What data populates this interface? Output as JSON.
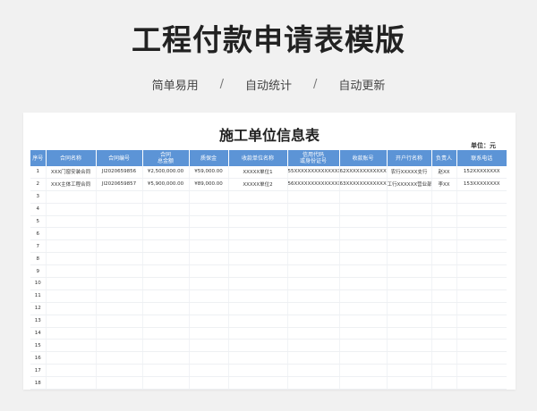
{
  "header": {
    "title": "工程付款申请表模版",
    "taglines": [
      "简单易用",
      "自动统计",
      "自动更新"
    ],
    "separator": "/"
  },
  "sheet": {
    "title": "施工单位信息表",
    "unit": "单位：元",
    "columns": [
      {
        "line1": "序号",
        "line2": ""
      },
      {
        "line1": "合同名称",
        "line2": ""
      },
      {
        "line1": "合同编号",
        "line2": ""
      },
      {
        "line1": "合同",
        "line2": "总金额"
      },
      {
        "line1": "质保金",
        "line2": ""
      },
      {
        "line1": "收款单位名称",
        "line2": ""
      },
      {
        "line1": "信用代码",
        "line2": "或身份证号"
      },
      {
        "line1": "收款账号",
        "line2": ""
      },
      {
        "line1": "开户行名称",
        "line2": ""
      },
      {
        "line1": "负责人",
        "line2": ""
      },
      {
        "line1": "联系电话",
        "line2": ""
      }
    ],
    "rows": [
      [
        "1",
        "XXX门窗安装合同",
        "JI2020659856",
        "¥2,500,000.00",
        "¥59,000.00",
        "XXXXX单位1",
        "55XXXXXXXXXXXXXX",
        "62XXXXXXXXXXXX",
        "农行XXXXX支行",
        "赵XX",
        "152XXXXXXXX"
      ],
      [
        "2",
        "XXX主体工程合同",
        "JI2020659857",
        "¥5,900,000.00",
        "¥89,000.00",
        "XXXXX单位2",
        "56XXXXXXXXXXXXXX",
        "63XXXXXXXXXXXX",
        "工行XXXXXX营业部",
        "李XX",
        "153XXXXXXXX"
      ],
      [
        "3",
        "",
        "",
        "",
        "",
        "",
        "",
        "",
        "",
        "",
        ""
      ],
      [
        "4",
        "",
        "",
        "",
        "",
        "",
        "",
        "",
        "",
        "",
        ""
      ],
      [
        "5",
        "",
        "",
        "",
        "",
        "",
        "",
        "",
        "",
        "",
        ""
      ],
      [
        "6",
        "",
        "",
        "",
        "",
        "",
        "",
        "",
        "",
        "",
        ""
      ],
      [
        "7",
        "",
        "",
        "",
        "",
        "",
        "",
        "",
        "",
        "",
        ""
      ],
      [
        "8",
        "",
        "",
        "",
        "",
        "",
        "",
        "",
        "",
        "",
        ""
      ],
      [
        "9",
        "",
        "",
        "",
        "",
        "",
        "",
        "",
        "",
        "",
        ""
      ],
      [
        "10",
        "",
        "",
        "",
        "",
        "",
        "",
        "",
        "",
        "",
        ""
      ],
      [
        "11",
        "",
        "",
        "",
        "",
        "",
        "",
        "",
        "",
        "",
        ""
      ],
      [
        "12",
        "",
        "",
        "",
        "",
        "",
        "",
        "",
        "",
        "",
        ""
      ],
      [
        "13",
        "",
        "",
        "",
        "",
        "",
        "",
        "",
        "",
        "",
        ""
      ],
      [
        "14",
        "",
        "",
        "",
        "",
        "",
        "",
        "",
        "",
        "",
        ""
      ],
      [
        "15",
        "",
        "",
        "",
        "",
        "",
        "",
        "",
        "",
        "",
        ""
      ],
      [
        "16",
        "",
        "",
        "",
        "",
        "",
        "",
        "",
        "",
        "",
        ""
      ],
      [
        "17",
        "",
        "",
        "",
        "",
        "",
        "",
        "",
        "",
        "",
        ""
      ],
      [
        "18",
        "",
        "",
        "",
        "",
        "",
        "",
        "",
        "",
        "",
        ""
      ]
    ]
  },
  "colors": {
    "header_bg": "#5c94d6",
    "page_bg": "#f1f1f1",
    "sheet_bg": "#ffffff"
  }
}
